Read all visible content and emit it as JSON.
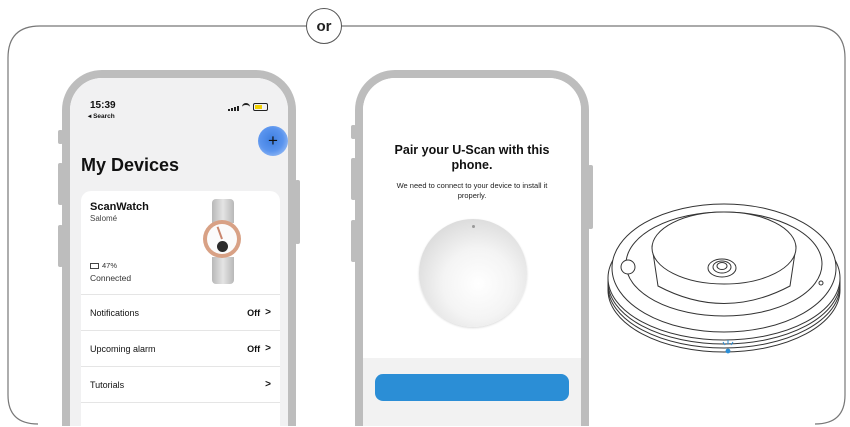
{
  "separator": {
    "label": "or"
  },
  "phone_devices": {
    "status": {
      "time": "15:39",
      "back": "◂ Search"
    },
    "add_button": "+",
    "title": "My Devices",
    "device": {
      "name": "ScanWatch",
      "owner": "Salomé",
      "battery": "47%",
      "connection": "Connected"
    },
    "rows": [
      {
        "label": "Notifications",
        "value": "Off",
        "chevron": ">"
      },
      {
        "label": "Upcoming alarm",
        "value": "Off",
        "chevron": ">"
      },
      {
        "label": "Tutorials",
        "value": "",
        "chevron": ">"
      }
    ]
  },
  "phone_pair": {
    "title": "Pair your U-Scan with this phone.",
    "subtitle": "We need to connect to your device to install it properly."
  },
  "colors": {
    "accent_blue": "#2b8ed6",
    "add_button_blue": "#3f7fe0",
    "led_blue": "#2b8ed6",
    "phone_frame": "#bdbdbd"
  }
}
